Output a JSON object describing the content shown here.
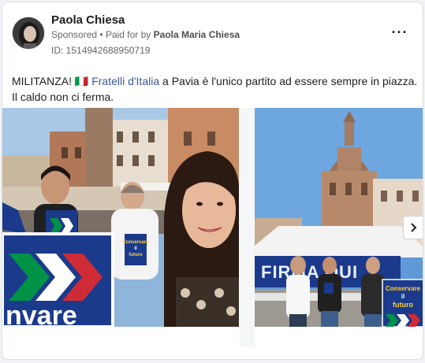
{
  "post": {
    "author": "Paola Chiesa",
    "sponsored": "Sponsored",
    "paid_for_prefix": "Paid for by",
    "paid_for_name": "Paola Maria Chiesa",
    "library_id": "ID: 1514942688950719",
    "text_before": "MILITANZA! 🇮🇹 ",
    "text_link": "Fratelli d'Italia",
    "text_after": " a Pavia è l'unico partito ad essere sempre in piazza. Il caldo non ci ferma."
  },
  "photo1": {
    "sign_text": "nvare",
    "flyer_lines": [
      "Conservare",
      "il",
      "futuro"
    ]
  },
  "photo2": {
    "gazebo_text": "FIRMA QUI",
    "banner_lines": [
      "Conservare",
      "il",
      "futuro"
    ]
  },
  "icons": {
    "more": "more-options-icon",
    "next": "chevron-right-icon",
    "flag": "italy-flag-icon"
  },
  "colors": {
    "link": "#385898",
    "secondary_text": "#65676b",
    "party_blue": "#1b3a8c",
    "fdi_green": "#009246",
    "fdi_red": "#ce2b37"
  }
}
